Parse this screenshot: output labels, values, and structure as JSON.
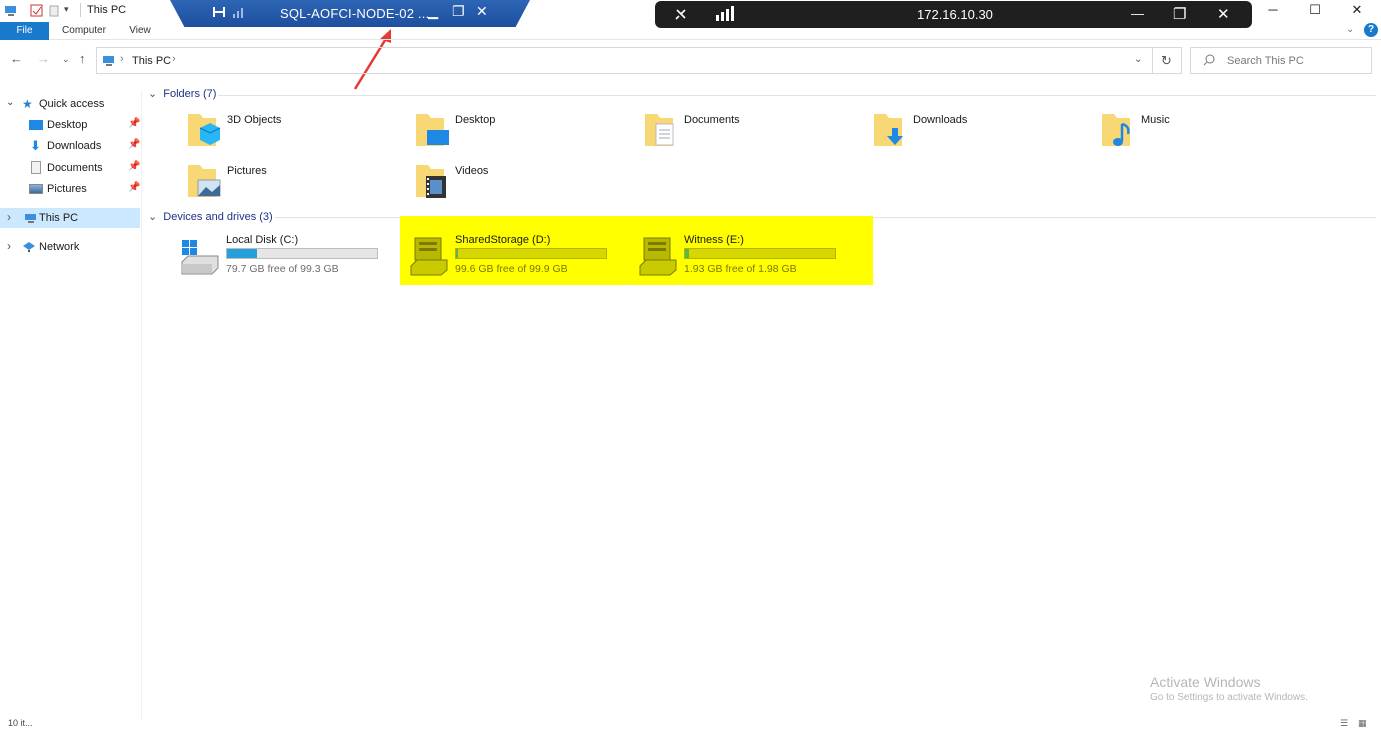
{
  "window": {
    "title": "This PC",
    "minimize": "─",
    "maximize": "☐",
    "close": "✕"
  },
  "rdp_bar": {
    "title": "SQL-AOFCI-NODE-02 ...",
    "pin": "⌖",
    "signal": "📶",
    "minimize": "▁",
    "restore": "❐",
    "close": "✕"
  },
  "connection_bar": {
    "ip": "172.16.10.30",
    "minimize": "—",
    "restore": "❐",
    "close": "✕"
  },
  "ribbon": {
    "tabs": [
      "File",
      "Computer",
      "View"
    ]
  },
  "address": {
    "crumb": "This PC",
    "search_placeholder": "Search This PC"
  },
  "nav_pane": {
    "quick_access": "Quick access",
    "items": [
      {
        "label": "Desktop",
        "pinned": true
      },
      {
        "label": "Downloads",
        "pinned": true
      },
      {
        "label": "Documents",
        "pinned": true
      },
      {
        "label": "Pictures",
        "pinned": true
      }
    ],
    "this_pc": "This PC",
    "network": "Network"
  },
  "folders": {
    "header": "Folders (7)",
    "items": [
      "3D Objects",
      "Desktop",
      "Documents",
      "Downloads",
      "Music",
      "Pictures",
      "Videos"
    ]
  },
  "drives": {
    "header": "Devices and drives (3)",
    "items": [
      {
        "name": "Local Disk (C:)",
        "free": "79.7 GB free of 99.3 GB",
        "used_fraction": 0.2
      },
      {
        "name": "SharedStorage (D:)",
        "free": "99.6 GB free of 99.9 GB",
        "used_fraction": 0.003
      },
      {
        "name": "Witness (E:)",
        "free": "1.93 GB free of 1.98 GB",
        "used_fraction": 0.025
      }
    ]
  },
  "watermark": {
    "line1": "Activate Windows",
    "line2": "Go to Settings to activate Windows."
  },
  "status": {
    "items": "10 it..."
  },
  "colors": {
    "accent": "#1979ca",
    "highlight": "#ffff00",
    "rdp_blue": "#1d4f9e"
  }
}
